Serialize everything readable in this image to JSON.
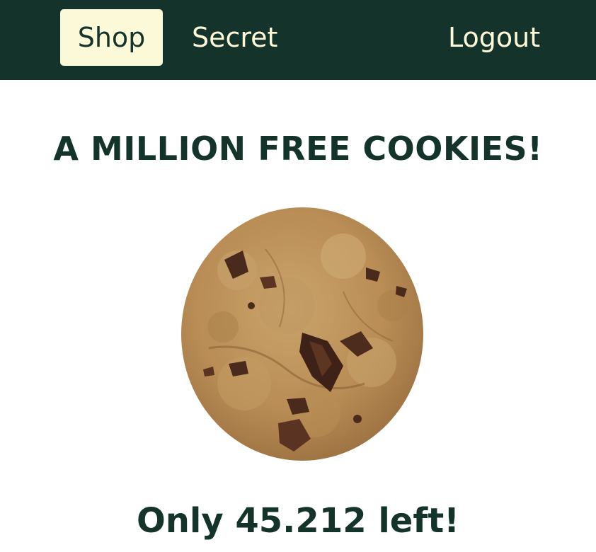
{
  "nav": {
    "shop_label": "Shop",
    "secret_label": "Secret",
    "logout_label": "Logout",
    "active_item": "Shop"
  },
  "main": {
    "headline": "A MILLION FREE COOKIES!",
    "cookie_image": "chocolate-chip-cookie",
    "remaining_text": "Only 45.212 left!"
  },
  "colors": {
    "navbar_bg": "#14342b",
    "nav_text": "#fdf8d8",
    "active_bg": "#fcf9d9",
    "heading": "#14342b"
  }
}
